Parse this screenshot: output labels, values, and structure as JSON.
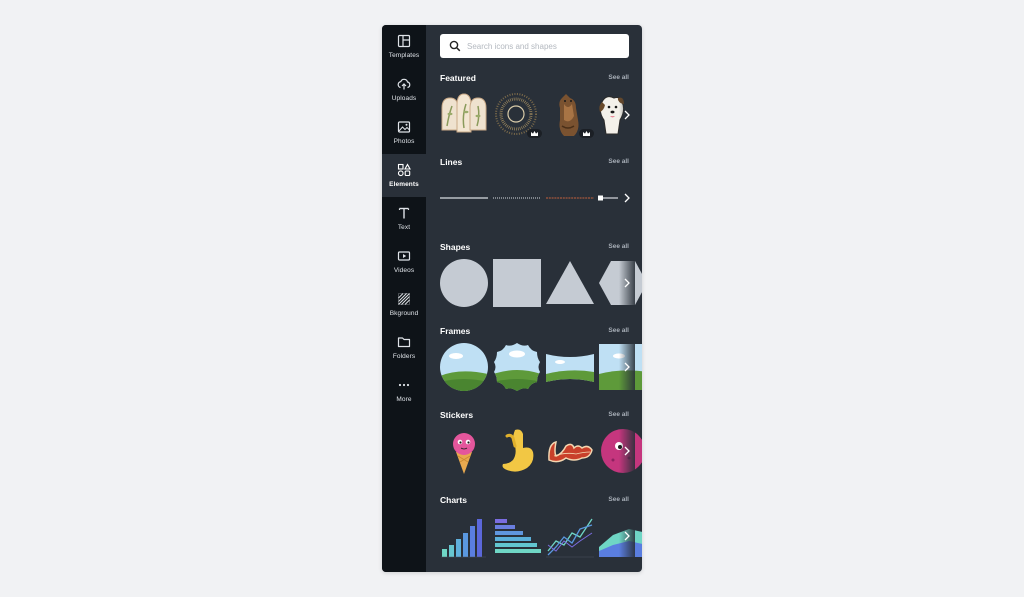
{
  "rail": {
    "items": [
      {
        "label": "Templates",
        "icon": "templates-icon"
      },
      {
        "label": "Uploads",
        "icon": "upload-cloud-icon"
      },
      {
        "label": "Photos",
        "icon": "image-icon"
      },
      {
        "label": "Elements",
        "icon": "shapes-icon",
        "active": true
      },
      {
        "label": "Text",
        "icon": "text-icon"
      },
      {
        "label": "Videos",
        "icon": "video-icon"
      },
      {
        "label": "Bkground",
        "icon": "hatch-icon"
      },
      {
        "label": "Folders",
        "icon": "folder-icon"
      },
      {
        "label": "More",
        "icon": "more-icon"
      }
    ]
  },
  "search": {
    "placeholder": "Search icons and shapes"
  },
  "sections": {
    "featured": {
      "title": "Featured",
      "see_all": "See all"
    },
    "lines": {
      "title": "Lines",
      "see_all": "See all"
    },
    "shapes": {
      "title": "Shapes",
      "see_all": "See all"
    },
    "frames": {
      "title": "Frames",
      "see_all": "See all"
    },
    "stickers": {
      "title": "Stickers",
      "see_all": "See all"
    },
    "charts": {
      "title": "Charts",
      "see_all": "See all"
    }
  },
  "colors": {
    "rail_bg": "#0e1318",
    "panel_bg": "#293039",
    "shape_fill": "#c5cbd3",
    "sky": "#bfe0f4",
    "grass": "#5e9a3a"
  }
}
